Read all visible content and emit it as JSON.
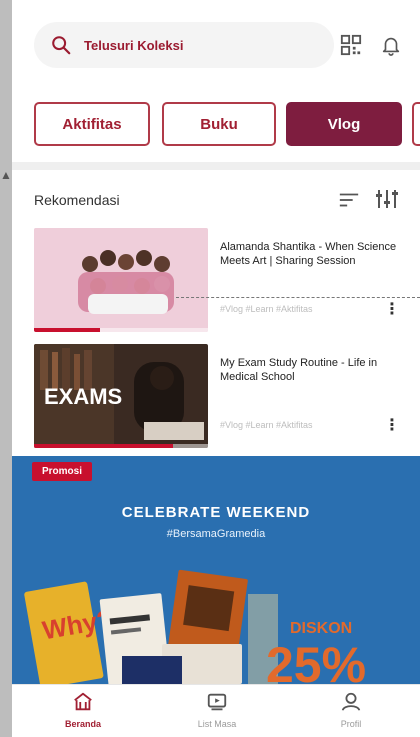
{
  "header": {
    "search_placeholder": "Telusuri Koleksi",
    "search_icon": "search-icon",
    "qr_icon": "qr-icon",
    "bell_icon": "bell-icon"
  },
  "tabs": [
    {
      "label": "Aktifitas",
      "active": false
    },
    {
      "label": "Buku",
      "active": false
    },
    {
      "label": "Vlog",
      "active": true
    },
    {
      "label": "",
      "active": false
    }
  ],
  "recommendations": {
    "title": "Rekomendasi",
    "sort_icon": "sort-icon",
    "filter_icon": "filter-icon",
    "items": [
      {
        "title": "Alamanda Shantika - When Science Meets Art | Sharing Session",
        "tags": "#Vlog #Learn #Aktifitas",
        "progress": 0.38,
        "thumb_bg": "#e8bccb"
      },
      {
        "title": "My Exam Study Routine - Life in Medical School",
        "tags": "#Vlog #Learn #Aktifitas",
        "progress": 0.8,
        "thumb_bg": "#3a2a22",
        "thumb_text": "EXAMS"
      }
    ]
  },
  "promo": {
    "badge": "Promosi",
    "title": "CELEBRATE WEEKEND",
    "subtitle": "#BersamaGramedia",
    "diskon": "DISKON",
    "big": "25%",
    "bg": "#2a6fb0"
  },
  "bottom_nav": [
    {
      "label": "Beranda",
      "icon": "home-icon",
      "active": true
    },
    {
      "label": "List Masa",
      "icon": "list-icon",
      "active": false
    },
    {
      "label": "Profil",
      "icon": "profile-icon",
      "active": false
    }
  ],
  "colors": {
    "brand": "#a12033",
    "accent": "#7e1d3f",
    "progress": "#c8102e"
  }
}
